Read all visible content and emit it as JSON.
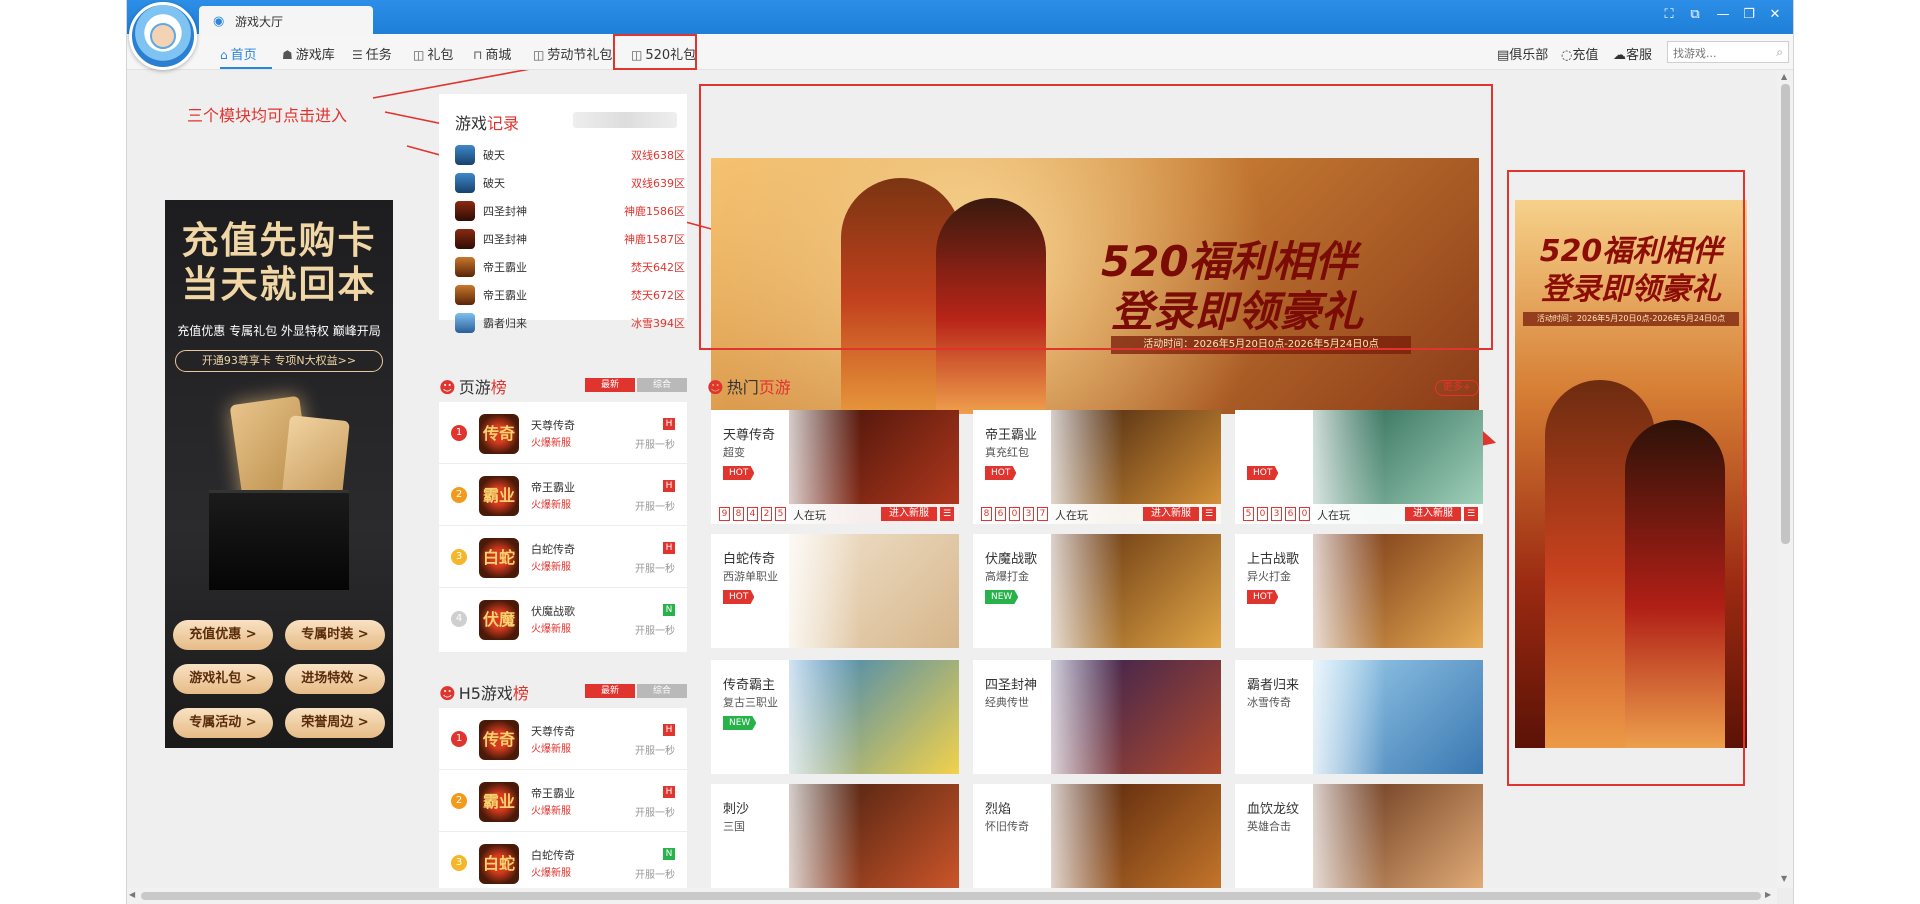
{
  "window": {
    "tab_label": "游戏大厅",
    "controls": [
      "⛶",
      "⧉",
      "—",
      "❐",
      "✕"
    ]
  },
  "nav": {
    "items": [
      {
        "icon": "⌂",
        "label": "首页"
      },
      {
        "icon": "☗",
        "label": "游戏库"
      },
      {
        "icon": "☰",
        "label": "任务"
      },
      {
        "icon": "◫",
        "label": "礼包"
      },
      {
        "icon": "⊓",
        "label": "商城"
      },
      {
        "icon": "◫",
        "label": "劳动节礼包"
      },
      {
        "icon": "◫",
        "label": "520礼包"
      }
    ],
    "right": [
      {
        "icon": "▤",
        "label": "俱乐部"
      },
      {
        "icon": "◌",
        "label": "充值"
      },
      {
        "icon": "☁",
        "label": "客服"
      }
    ],
    "search_placeholder": "找游戏..."
  },
  "annotation": "三个模块均可点击进入",
  "left_banner": {
    "title1": "充值先购卡",
    "title2": "当天就回本",
    "subtitle": "充值优惠 专属礼包 外显特权 巅峰开局",
    "pill": "开通93尊享卡 专项N大权益>>",
    "buttons": [
      "充值优惠 >",
      "专属时装 >",
      "游戏礼包 >",
      "进场特效 >",
      "专属活动 >",
      "荣誉周边 >"
    ]
  },
  "game_record": {
    "title_a": "游戏",
    "title_b": "记录",
    "rows": [
      {
        "name": "破天",
        "server": "双线638区"
      },
      {
        "name": "破天",
        "server": "双线639区"
      },
      {
        "name": "四圣封神",
        "server": "神鹿1586区"
      },
      {
        "name": "四圣封神",
        "server": "神鹿1587区"
      },
      {
        "name": "帝王霸业",
        "server": "焚天642区"
      },
      {
        "name": "帝王霸业",
        "server": "焚天672区"
      },
      {
        "name": "霸者归来",
        "server": "冰雪394区"
      }
    ]
  },
  "page_rank": {
    "title_a": "页游",
    "title_b": "榜",
    "tab_new": "最新",
    "tab_all": "综合",
    "rows": [
      {
        "num": "1",
        "icon_text": "传奇",
        "name": "天尊传奇",
        "sub": "火爆新服",
        "badge": "H",
        "time": "开服一秒"
      },
      {
        "num": "2",
        "icon_text": "霸业",
        "name": "帝王霸业",
        "sub": "火爆新服",
        "badge": "H",
        "time": "开服一秒"
      },
      {
        "num": "3",
        "icon_text": "白蛇",
        "name": "白蛇传奇",
        "sub": "火爆新服",
        "badge": "H",
        "time": "开服一秒"
      },
      {
        "num": "4",
        "icon_text": "伏魔",
        "name": "伏魔战歌",
        "sub": "火爆新服",
        "badge": "N",
        "time": "开服一秒"
      }
    ]
  },
  "h5_rank": {
    "title_a": "H5游戏",
    "title_b": "榜",
    "tab_new": "最新",
    "tab_all": "综合",
    "rows": [
      {
        "num": "1",
        "icon_text": "传奇",
        "name": "天尊传奇",
        "sub": "火爆新服",
        "badge": "H",
        "time": "开服一秒"
      },
      {
        "num": "2",
        "icon_text": "霸业",
        "name": "帝王霸业",
        "sub": "火爆新服",
        "badge": "H",
        "time": "开服一秒"
      },
      {
        "num": "3",
        "icon_text": "白蛇",
        "name": "白蛇传奇",
        "sub": "火爆新服",
        "badge": "N",
        "time": "开服一秒"
      }
    ]
  },
  "carousel": {
    "title1": "520福利相伴",
    "title2": "登录即领豪礼",
    "time": "活动时间：2026年5月20日0点-2026年5月24日0点"
  },
  "hot_games": {
    "title_a": "热门",
    "title_b": "页游",
    "more": "更多+",
    "playing_label": "人在玩",
    "enter_label": "进入新服",
    "cards": [
      {
        "name": "天尊传奇",
        "sub": "超变",
        "tag": "HOT",
        "digits": [
          "9",
          "8",
          "4",
          "2",
          "5"
        ],
        "colors": [
          "#3a0f08",
          "#b73a1e"
        ]
      },
      {
        "name": "帝王霸业",
        "sub": "真充红包",
        "tag": "HOT",
        "digits": [
          "8",
          "6",
          "0",
          "3",
          "7"
        ],
        "colors": [
          "#3b1c0c",
          "#e09a3a"
        ]
      },
      {
        "name": "",
        "sub": "",
        "tag": "HOT",
        "digits": [
          "5",
          "0",
          "3",
          "6",
          "0"
        ],
        "colors": [
          "#1f5e4a",
          "#a9d8c2"
        ]
      },
      {
        "name": "白蛇传奇",
        "sub": "西游单职业",
        "tag": "HOT",
        "colors": [
          "#f1e3cf",
          "#d6b68a"
        ]
      },
      {
        "name": "伏魔战歌",
        "sub": "高爆打金",
        "tag": "NEW",
        "colors": [
          "#5a2a0c",
          "#e0a646"
        ]
      },
      {
        "name": "上古战歌",
        "sub": "异火打金",
        "tag": "HOT",
        "colors": [
          "#6b2a0e",
          "#e7ad54"
        ]
      },
      {
        "name": "传奇霸主",
        "sub": "复古三职业",
        "tag": "NEW",
        "colors": [
          "#2e7fc1",
          "#f2d24a"
        ]
      },
      {
        "name": "四圣封神",
        "sub": "经典传世",
        "tag": "",
        "colors": [
          "#2b1d54",
          "#b04a2c"
        ]
      },
      {
        "name": "霸者归来",
        "sub": "冰雪传奇",
        "tag": "",
        "colors": [
          "#9fd0ec",
          "#3a78b2"
        ]
      },
      {
        "name": "刺沙",
        "sub": "三国",
        "tag": "",
        "colors": [
          "#3a1a0e",
          "#d0572a"
        ]
      },
      {
        "name": "烈焰",
        "sub": "怀旧传奇",
        "tag": "",
        "colors": [
          "#4a1c08",
          "#c8782c"
        ]
      },
      {
        "name": "血饮龙纹",
        "sub": "英雄合击",
        "tag": "",
        "colors": [
          "#5a2a14",
          "#e6b07a"
        ]
      }
    ]
  },
  "right_banner": {
    "title1": "520福利相伴",
    "title2": "登录即领豪礼",
    "time": "活动时间：2026年5月20日0点-2026年5月24日0点"
  },
  "colors": {
    "accent_red": "#e0342f",
    "accent_blue": "#2b86de",
    "tag_new_green": "#27b34a"
  }
}
